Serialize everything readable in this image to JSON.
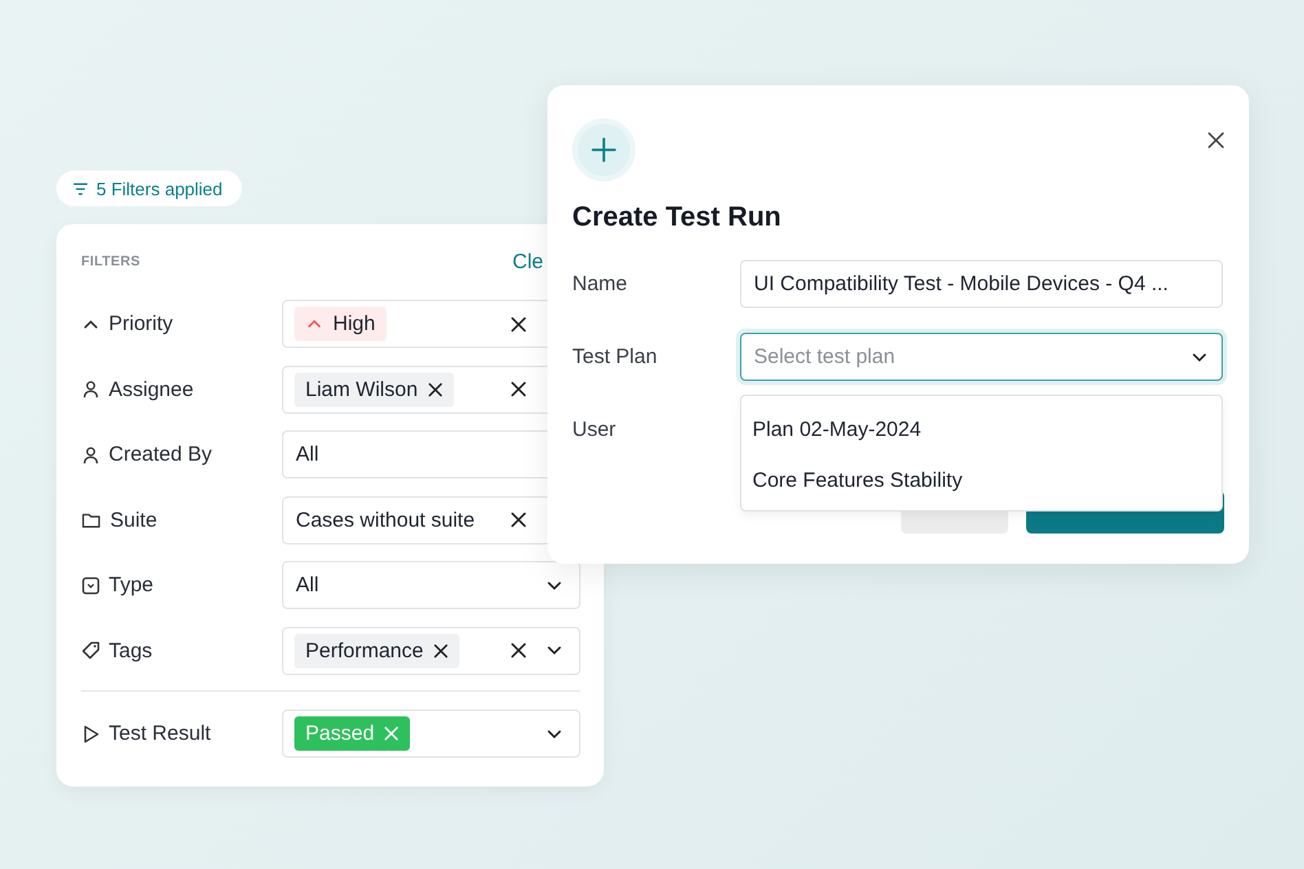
{
  "filter_badge": {
    "text": "5 Filters applied"
  },
  "filters": {
    "heading": "FILTERS",
    "clear_link": "Cle",
    "rows": [
      {
        "label": "Priority",
        "chips": [
          {
            "text": "High",
            "kind": "priority",
            "removable": false
          }
        ],
        "value": null,
        "clearable": true,
        "divider_before": false
      },
      {
        "label": "Assignee",
        "chips": [
          {
            "text": "Liam Wilson",
            "kind": "tag",
            "removable": true
          }
        ],
        "value": null,
        "clearable": true,
        "divider_before": false
      },
      {
        "label": "Created By",
        "chips": [],
        "value": "All",
        "clearable": false,
        "divider_before": false
      },
      {
        "label": "Suite",
        "chips": [],
        "value": "Cases without suite",
        "clearable": true,
        "divider_before": false
      },
      {
        "label": "Type",
        "chips": [],
        "value": "All",
        "clearable": false,
        "dropdown": true,
        "divider_before": false
      },
      {
        "label": "Tags",
        "chips": [
          {
            "text": "Performance",
            "kind": "tag",
            "removable": true
          }
        ],
        "value": null,
        "clearable": true,
        "dropdown": true,
        "divider_before": false
      },
      {
        "label": "Test Result",
        "chips": [
          {
            "text": "Passed",
            "kind": "status",
            "removable": true
          }
        ],
        "value": null,
        "clearable": false,
        "dropdown": true,
        "divider_before": true
      }
    ]
  },
  "dialog": {
    "title": "Create Test Run",
    "fields": [
      {
        "label": "Name",
        "kind": "text",
        "value": "UI Compatibility Test - Mobile Devices - Q4 ...",
        "focused": false
      },
      {
        "label": "Test Plan",
        "kind": "select",
        "placeholder": "Select test plan",
        "focused": true
      },
      {
        "label": "User",
        "kind": "hidden"
      }
    ],
    "dropdown_options": [
      {
        "text": "Plan 02-May-2024"
      },
      {
        "text": "Core Features Stability"
      }
    ],
    "buttons": [
      {
        "kind": "secondary"
      },
      {
        "kind": "primary"
      }
    ]
  }
}
